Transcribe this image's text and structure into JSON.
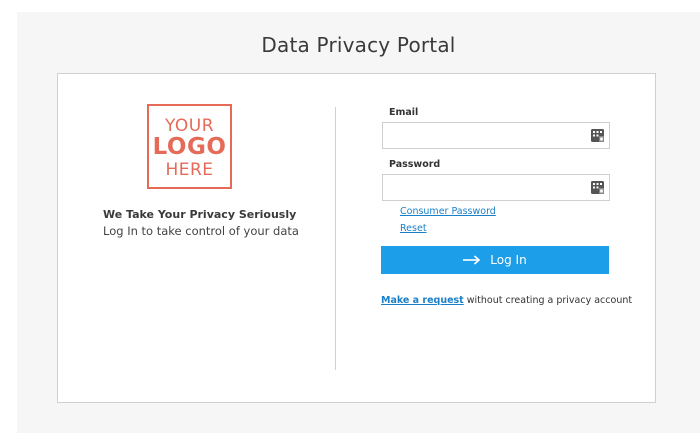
{
  "page": {
    "title": "Data Privacy Portal"
  },
  "logo": {
    "line1": "YOUR",
    "line2": "LOGO",
    "line3": "HERE",
    "color": "#e56a58"
  },
  "intro": {
    "tagline": "We Take Your Privacy Seriously",
    "subtitle": "Log In to take control of your data"
  },
  "form": {
    "email_label": "Email",
    "email_value": "",
    "email_placeholder": "",
    "password_label": "Password",
    "password_value": "",
    "password_placeholder": "",
    "field_icon": "keypad-icon",
    "consumer_password_link": "Consumer Password",
    "reset_link": "Reset",
    "login_button": "Log In",
    "login_icon": "arrow-right-icon",
    "button_color": "#1d9ee8",
    "request_link": "Make a request",
    "request_suffix": " without creating a privacy account"
  }
}
